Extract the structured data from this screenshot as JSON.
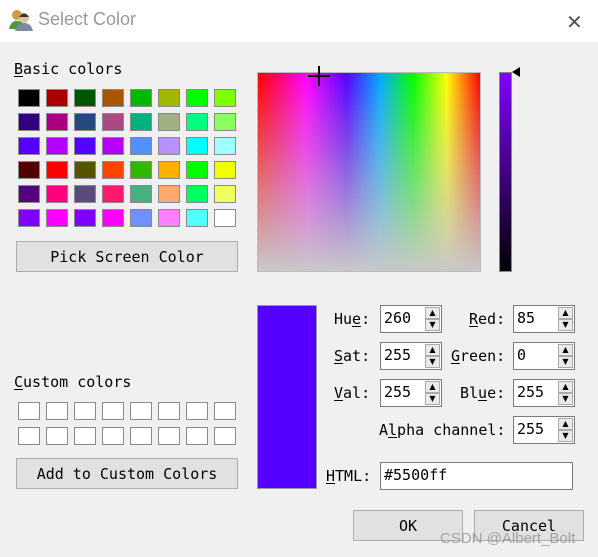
{
  "window": {
    "title": "Select Color",
    "close_icon": "close-icon",
    "app_icon": "users-icon"
  },
  "basic": {
    "label": "Basic colors",
    "colors": [
      [
        "#000000",
        "#aa0000",
        "#005500",
        "#aa5500",
        "#00b800",
        "#a0b800",
        "#00ff00",
        "#80ff00"
      ],
      [
        "#2f007f",
        "#aa007f",
        "#254a80",
        "#aa4a80",
        "#00b07f",
        "#a0b07f",
        "#00ff7f",
        "#8aff60"
      ],
      [
        "#5500ff",
        "#b500ff",
        "#5500ff",
        "#b500ff",
        "#5090ff",
        "#b890ff",
        "#00ffff",
        "#a0ffff"
      ],
      [
        "#550000",
        "#ff0000",
        "#555500",
        "#ff4500",
        "#30b800",
        "#ffb000",
        "#00ff00",
        "#f0ff00"
      ],
      [
        "#55007f",
        "#ff007f",
        "#5a4a80",
        "#ff1a70",
        "#48b07f",
        "#ffa870",
        "#00ff60",
        "#f0ff60"
      ],
      [
        "#7f00ff",
        "#ff00ff",
        "#7f00ff",
        "#ff00ff",
        "#7090ff",
        "#ff80ff",
        "#50ffff",
        "#ffffff"
      ]
    ]
  },
  "pick_screen": "Pick Screen Color",
  "custom": {
    "label": "Custom colors",
    "count": 16
  },
  "add_custom": "Add to Custom Colors",
  "current_color": "#5500ff",
  "fields": {
    "hue": {
      "label": "Hue:",
      "value": "260"
    },
    "sat": {
      "label": "Sat:",
      "value": "255"
    },
    "val": {
      "label": "Val:",
      "value": "255"
    },
    "red": {
      "label": "Red:",
      "value": "85"
    },
    "green": {
      "label": "Green:",
      "value": "0"
    },
    "blue": {
      "label": "Blue:",
      "value": "255"
    },
    "alpha": {
      "label": "Alpha channel:",
      "value": "255"
    },
    "html": {
      "label": "HTML:",
      "value": "#5500ff"
    }
  },
  "ok": "OK",
  "cancel": "Cancel",
  "watermark": "CSDN @Albert_Bolt"
}
